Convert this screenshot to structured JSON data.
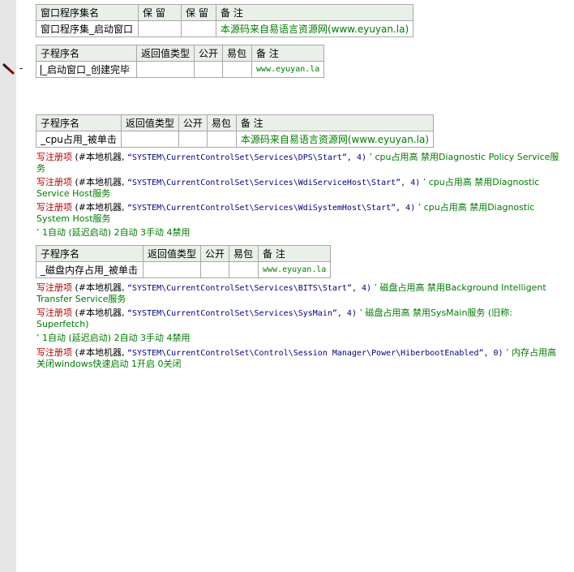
{
  "window_table": {
    "headers": [
      "窗口程序集名",
      "保 留",
      "保 留",
      "备 注"
    ],
    "row": {
      "name": "窗口程序集_启动窗口",
      "r1": "",
      "r2": "",
      "note": "本源码来自易语言资源网(www.eyuyan.la)"
    }
  },
  "sub1": {
    "headers": [
      "子程序名",
      "返回值类型",
      "公开",
      "易包",
      "备 注"
    ],
    "row": {
      "name": "_启动窗口_创建完毕",
      "ret": "",
      "pub": "",
      "pkg": "",
      "note": "www.eyuyan.la"
    }
  },
  "sub2": {
    "headers": [
      "子程序名",
      "返回值类型",
      "公开",
      "易包",
      "备 注"
    ],
    "row": {
      "name": "_cpu占用_被单击",
      "ret": "",
      "pub": "",
      "pkg": "",
      "note": "本源码来自易语言资源网(www.eyuyan.la)"
    }
  },
  "sub3": {
    "headers": [
      "子程序名",
      "返回值类型",
      "公开",
      "易包",
      "备 注"
    ],
    "row": {
      "name": "_磁盘内存占用_被单击",
      "ret": "",
      "pub": "",
      "pkg": "",
      "note": "www.eyuyan.la"
    }
  },
  "code": {
    "cpu1": {
      "kw": "写注册项",
      "args": " (#本地机器, ",
      "path": "“SYSTEM\\CurrentControlSet\\Services\\DPS\\Start”, 4)",
      "comment": " ’ cpu占用高  禁用Diagnostic Policy Service服务"
    },
    "cpu2": {
      "kw": "写注册项",
      "args": " (#本地机器, ",
      "path": "“SYSTEM\\CurrentControlSet\\Services\\WdiServiceHost\\Start”, 4)",
      "comment": " ’ cpu占用高  禁用Diagnostic Service Host服务"
    },
    "cpu3": {
      "kw": "写注册项",
      "args": " (#本地机器, ",
      "path": "“SYSTEM\\CurrentControlSet\\Services\\WdiSystemHost\\Start”, 4)",
      "comment": " ’ cpu占用高  禁用Diagnostic System Host服务"
    },
    "note1": "’ 1自动 (延迟启动) 2自动 3手动 4禁用",
    "disk1": {
      "kw": "写注册项",
      "args": " (#本地机器, ",
      "path": "“SYSTEM\\CurrentControlSet\\Services\\BITS\\Start”, 4)",
      "comment": " ’ 磁盘占用高  禁用Background Intelligent Transfer Service服务"
    },
    "disk2": {
      "kw": "写注册项",
      "args": " (#本地机器, ",
      "path": "“SYSTEM\\CurrentControlSet\\Services\\SysMain”, 4)",
      "comment": " ’ 磁盘占用高  禁用SysMain服务 (旧称: Superfetch)"
    },
    "note2": "’ 1自动 (延迟启动) 2自动 3手动 4禁用",
    "mem1": {
      "kw": "写注册项",
      "args": " (#本地机器, ",
      "path": "“SYSTEM\\CurrentControlSet\\Control\\Session Manager\\Power\\HiberbootEnabled”, 0)",
      "comment": " ’ 内存占用高  关闭windows快速启动  1开启 0关闭"
    }
  },
  "dash": "-",
  "icons": {
    "marker": "pencil-breakpoint-icon"
  }
}
